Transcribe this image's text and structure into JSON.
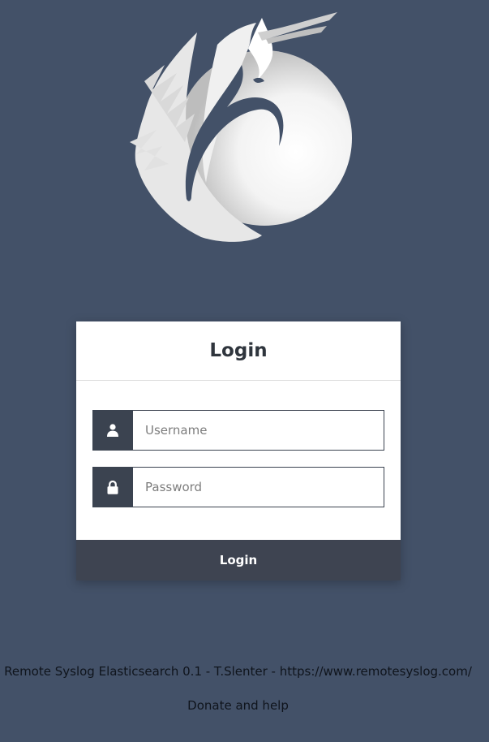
{
  "logo": {
    "icon": "phoenix-logo-icon"
  },
  "login_card": {
    "title": "Login",
    "username": {
      "placeholder": "Username",
      "value": "",
      "icon": "user-icon"
    },
    "password": {
      "placeholder": "Password",
      "value": "",
      "icon": "lock-icon"
    },
    "submit_label": "Login"
  },
  "footer": {
    "credit": "Remote Syslog Elasticsearch 0.1 - T.Slenter - https://www.remotesyslog.com/",
    "donate": "Donate and help"
  },
  "colors": {
    "background": "#435168",
    "card": "#ffffff",
    "addon": "#3b4350",
    "button": "#3e4451"
  }
}
